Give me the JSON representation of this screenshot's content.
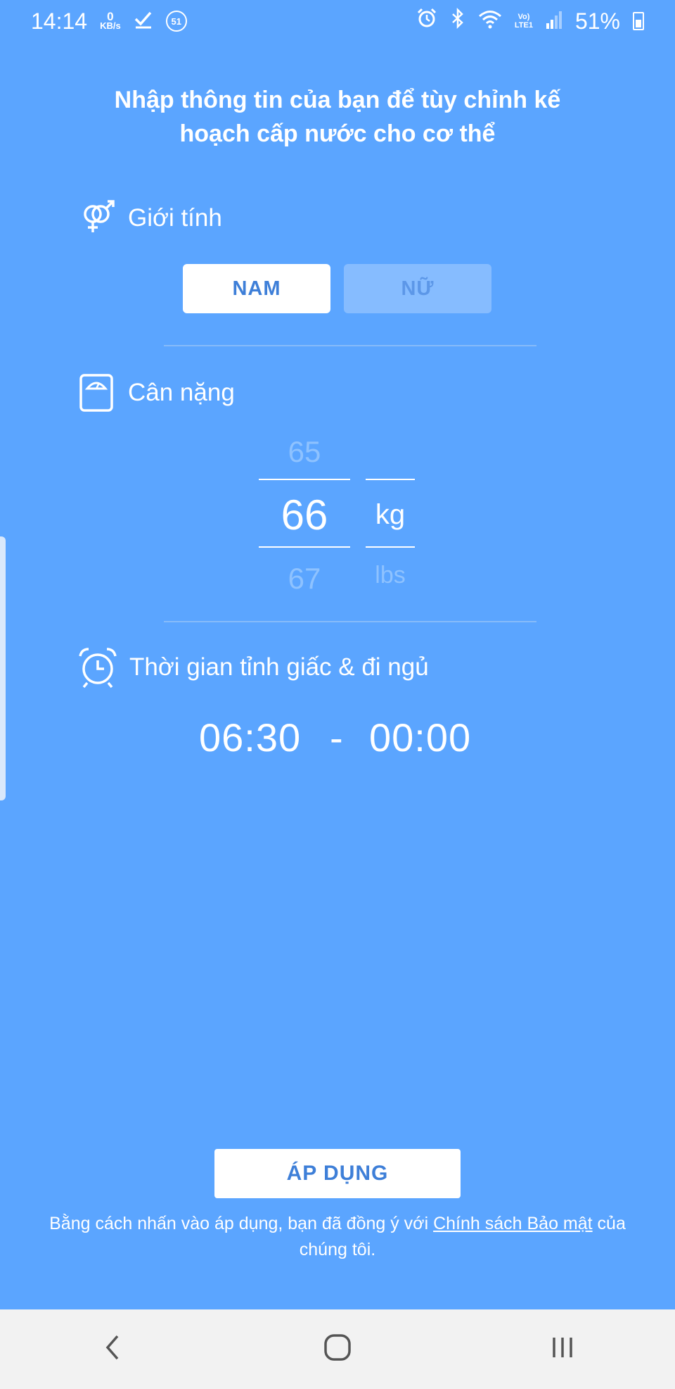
{
  "status_bar": {
    "time": "14:14",
    "data_speed_value": "0",
    "data_speed_unit": "KB/s",
    "notification_count": "51",
    "network_label_top": "Vo)",
    "network_label_bottom": "LTE1",
    "battery": "51%",
    "icons": [
      "download-check-icon",
      "alarm-icon",
      "bluetooth-icon",
      "wifi-icon",
      "signal-icon",
      "battery-icon"
    ]
  },
  "title": "Nhập thông tin của bạn để tùy chỉnh kế hoạch cấp nước cho cơ thể",
  "gender": {
    "label": "Giới tính",
    "icon": "gender-icon",
    "options": [
      "NAM",
      "NỮ"
    ],
    "selected": "NAM"
  },
  "weight": {
    "label": "Cân nặng",
    "icon": "scale-icon",
    "prev_value": "65",
    "value": "66",
    "next_value": "67",
    "unit": "kg",
    "alt_unit": "lbs"
  },
  "sleep": {
    "label": "Thời gian tỉnh giấc & đi ngủ",
    "icon": "alarm-clock-icon",
    "wake_time": "06:30",
    "separator": "-",
    "bed_time": "00:00"
  },
  "apply_button": "ÁP DỤNG",
  "consent": {
    "prefix": "Bằng cách nhấn vào áp dụng, bạn đã đồng ý với ",
    "link": "Chính sách Bảo mật",
    "suffix": " của chúng tôi."
  },
  "colors": {
    "background": "#5ba5ff",
    "accent_text": "#3e7fd8",
    "faded_text": "#8ec2ff",
    "navbar": "#f2f2f2"
  }
}
